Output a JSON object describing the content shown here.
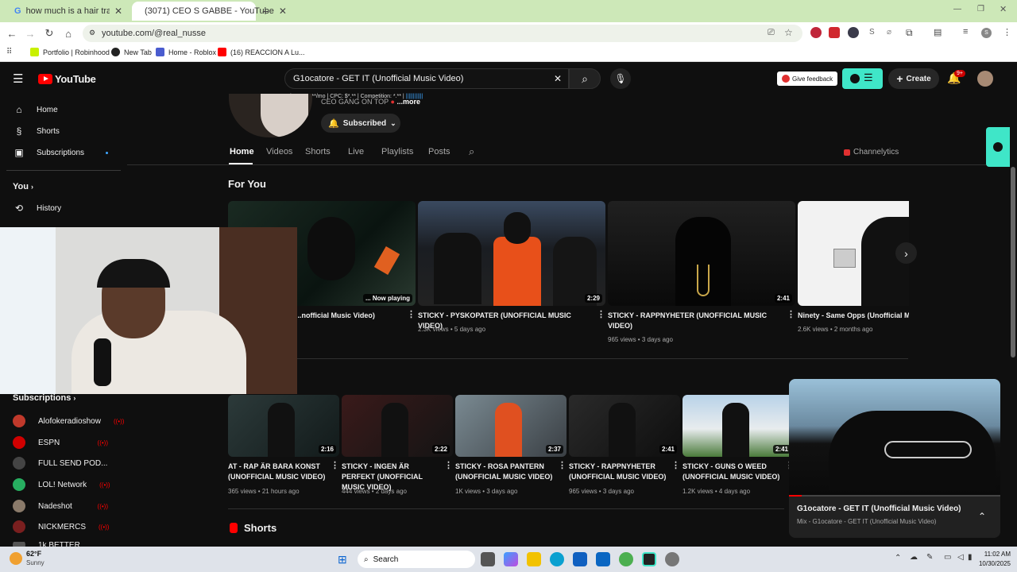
{
  "browser": {
    "tabs": [
      {
        "title": "how much is a hair transplant i"
      },
      {
        "title": "(3071) CEO S GABBE - YouTube"
      }
    ],
    "url": "youtube.com/@real_nusse",
    "bookmarks": [
      "Portfolio | Robinhood",
      "New Tab",
      "Home - Roblox",
      "(16) REACCION A Lu..."
    ]
  },
  "youtube": {
    "logo": "YouTube",
    "search_value": "G1ocatore - GET IT (Unofficial Music Video)",
    "feedback_label": "Give feedback",
    "create_label": "Create",
    "notif_badge": "9+",
    "seo_bar": "Volume: *****/mo | CPC: $*.** | Competition: *.** |"
  },
  "sidebar": {
    "items": [
      "Home",
      "Shorts",
      "Subscriptions"
    ],
    "you": "You",
    "history": "History",
    "subs_title": "Subscriptions",
    "subs": [
      {
        "name": "Alofokeradioshow",
        "color": "#c0392b",
        "status": "live"
      },
      {
        "name": "ESPN",
        "color": "#d00000",
        "status": "live"
      },
      {
        "name": "FULL SEND POD...",
        "color": "#444444",
        "status": "new"
      },
      {
        "name": "LOL! Network",
        "color": "#27ae60",
        "status": "live"
      },
      {
        "name": "Nadeshot",
        "color": "#8a7a6a",
        "status": "live"
      },
      {
        "name": "NICKMERCS",
        "color": "#7a1f1f",
        "status": "live"
      },
      {
        "name": "1k BETTER",
        "color": "#555555",
        "status": ""
      }
    ]
  },
  "channel": {
    "tagline": "CEO GANG ON TOP",
    "more": "...more",
    "subscribed": "Subscribed",
    "tabs": [
      "Home",
      "Videos",
      "Shorts",
      "Live",
      "Playlists",
      "Posts"
    ],
    "channelytics": "Channelytics",
    "for_you": "For You",
    "shorts_title": "Shorts"
  },
  "for_you_videos": [
    {
      "title": "...nofficial Music Video)",
      "meta": "",
      "duration": "... Now playing"
    },
    {
      "title": "STICKY - PYSKOPATER (UNOFFICIAL MUSIC VIDEO)",
      "meta": "2.3K views • 5 days ago",
      "duration": "2:29"
    },
    {
      "title": "STICKY - RAPPNYHETER (UNOFFICIAL MUSIC VIDEO)",
      "meta": "965 views • 3 days ago",
      "duration": "2:41"
    },
    {
      "title": "Ninety - Same Opps (Unofficial Mu",
      "meta": "2.6K views • 2 months ago",
      "duration": ""
    }
  ],
  "row_videos": [
    {
      "title": "AT - RAP ÄR BARA KONST (UNOFFICIAL MUSIC VIDEO)",
      "meta": "365 views • 21 hours ago",
      "duration": "2:16"
    },
    {
      "title": "STICKY - INGEN ÄR PERFEKT (UNOFFICIAL MUSIC VIDEO)",
      "meta": "444 views • 2 days ago",
      "duration": "2:22"
    },
    {
      "title": "STICKY - ROSA PANTERN (UNOFFICIAL MUSIC VIDEO)",
      "meta": "1K views • 3 days ago",
      "duration": "2:37"
    },
    {
      "title": "STICKY - RAPPNYHETER (UNOFFICIAL MUSIC VIDEO)",
      "meta": "965 views • 3 days ago",
      "duration": "2:41"
    },
    {
      "title": "STICKY - GUNS O WEED (UNOFFICIAL MUSIC VIDEO)",
      "meta": "1.2K views • 4 days ago",
      "duration": "2:41"
    }
  ],
  "miniplayer": {
    "title": "G1ocatore - GET IT (Unofficial Music Video)",
    "subtitle": "Mix - G1ocatore - GET IT (Unofficial Music Video)"
  },
  "taskbar": {
    "temp": "62°F",
    "weather": "Sunny",
    "search": "Search",
    "time": "11:02 AM",
    "date": "10/30/2025"
  }
}
